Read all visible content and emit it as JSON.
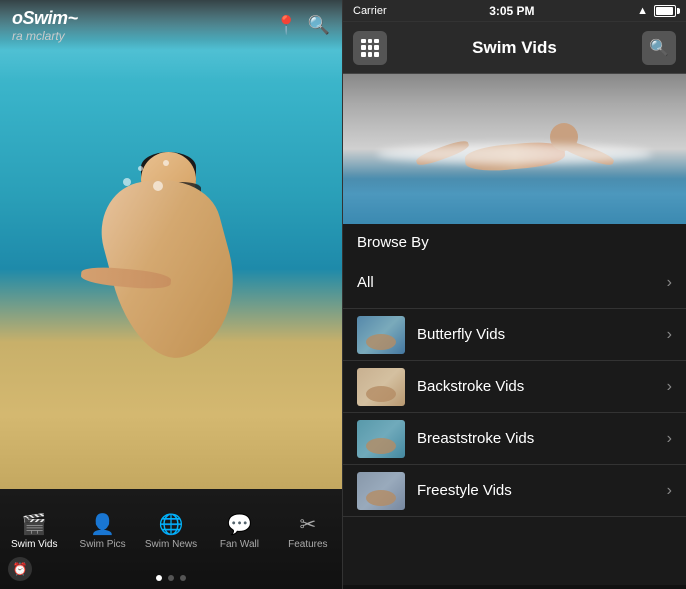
{
  "left": {
    "logo_line1": "oSwim~",
    "logo_line2": "ra mclarty",
    "nav_items": [
      {
        "id": "swim-vids",
        "label": "Swim Vids",
        "icon": "🎬",
        "active": true
      },
      {
        "id": "swim-pics",
        "label": "Swim Pics",
        "icon": "👤"
      },
      {
        "id": "swim-news",
        "label": "Swim News",
        "icon": "🌐"
      },
      {
        "id": "fan-wall",
        "label": "Fan Wall",
        "icon": "💬"
      },
      {
        "id": "features",
        "label": "Features",
        "icon": "✂"
      }
    ],
    "dots": [
      {
        "active": true
      },
      {
        "active": false
      },
      {
        "active": false
      }
    ]
  },
  "right": {
    "status_bar": {
      "carrier": "Carrier",
      "time": "3:05 PM",
      "battery": "85"
    },
    "title": "Swim Vids",
    "browse_by_label": "Browse By",
    "all_label": "All",
    "categories": [
      {
        "id": "butterfly",
        "label": "Butterfly Vids",
        "thumb_type": "butterfly"
      },
      {
        "id": "backstroke",
        "label": "Backstroke Vids",
        "thumb_type": "backstroke"
      },
      {
        "id": "breaststroke",
        "label": "Breaststroke Vids",
        "thumb_type": "breaststroke"
      },
      {
        "id": "freestyle",
        "label": "Freestyle Vids",
        "thumb_type": "freestyle"
      }
    ]
  }
}
